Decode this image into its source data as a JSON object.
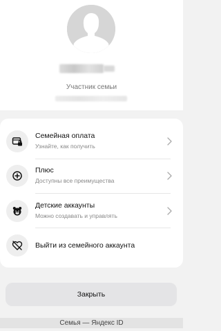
{
  "profile": {
    "role": "Участник семьи"
  },
  "menu": {
    "items": [
      {
        "title": "Семейная оплата",
        "subtitle": "Узнайте, как получить",
        "icon": "wallet-lock-icon",
        "has_chevron": true
      },
      {
        "title": "Плюс",
        "subtitle": "Доступны все преимущества",
        "icon": "plus-circle-icon",
        "has_chevron": true
      },
      {
        "title": "Детские аккаунты",
        "subtitle": "Можно создавать и управлять",
        "icon": "bear-face-icon",
        "has_chevron": true
      },
      {
        "title": "Выйти из семейного аккаунта",
        "icon": "broken-heart-icon",
        "has_chevron": false
      }
    ]
  },
  "actions": {
    "close_label": "Закрыть"
  },
  "footer": {
    "text": "Семья — Яндекс ID"
  },
  "colors": {
    "background": "#f2f2f2",
    "card": "#ffffff",
    "button": "#e4e4e6",
    "icon_bg": "#eeeeee",
    "secondary_text": "#888888"
  }
}
